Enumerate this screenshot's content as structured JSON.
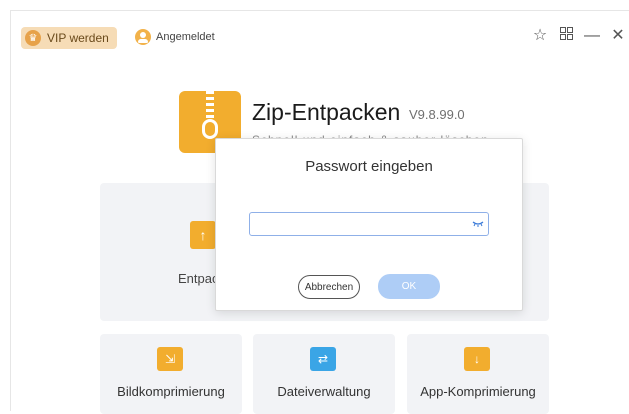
{
  "topbar": {
    "vip_label": "VIP werden",
    "login_label": "Angemeldet"
  },
  "icons": {
    "crown": "crown-icon",
    "avatar": "user-avatar-icon",
    "star": "star-icon",
    "grid": "grid-icon",
    "minimize": "minimize-icon",
    "close": "close-icon"
  },
  "app": {
    "title": "Zip-Entpacken",
    "version": "V9.8.99.0",
    "subtitle": "Schnell und einfach & sauber löschen"
  },
  "cards": {
    "main": {
      "label": "Entpac"
    },
    "items": [
      {
        "label": "Bildkomprimierung",
        "color": "#f2ad2e"
      },
      {
        "label": "Dateiverwaltung",
        "color": "#3aa5e6"
      },
      {
        "label": "App-Komprimierung",
        "color": "#f2ad2e"
      }
    ]
  },
  "dialog": {
    "title": "Passwort eingeben",
    "input_value": "",
    "cancel_label": "Abbrechen",
    "ok_label": "OK"
  },
  "colors": {
    "vip_bg": "#f6dcb6",
    "accent": "#f2ad2e",
    "ok_disabled": "#aecdf6",
    "input_border": "#8fb0e8"
  }
}
